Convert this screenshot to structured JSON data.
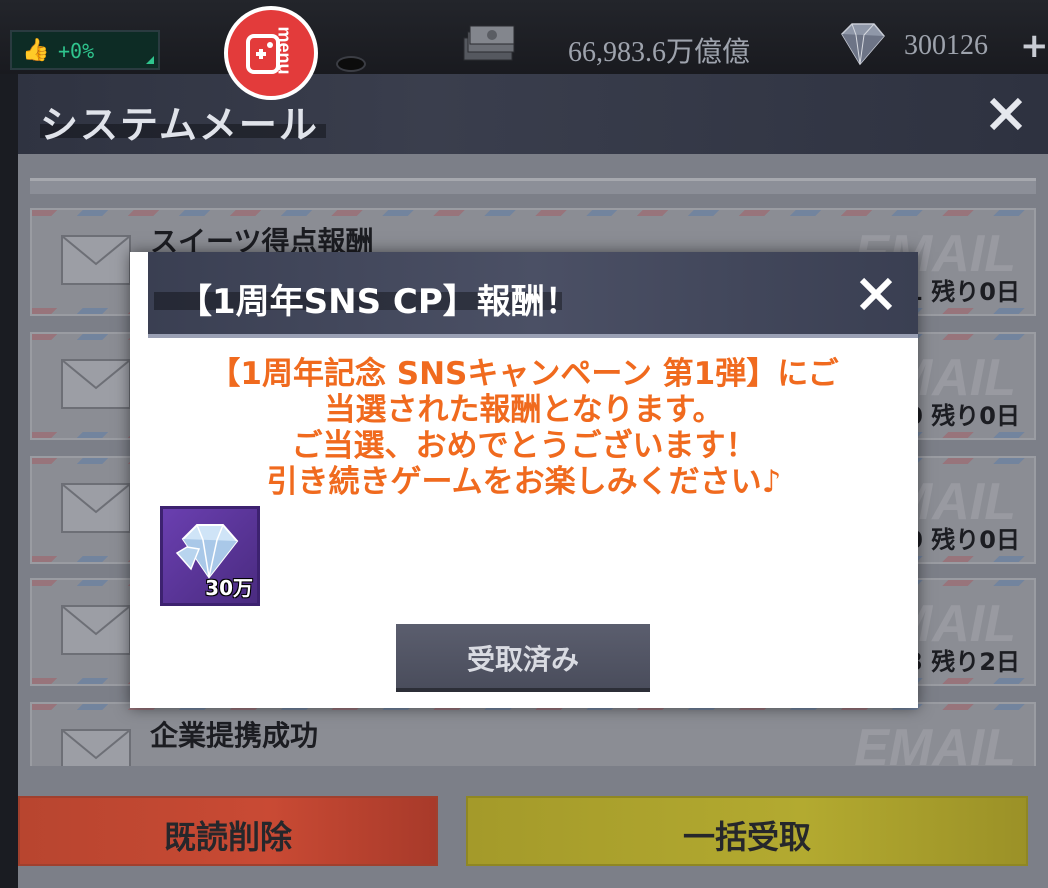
{
  "topbar": {
    "likes_percent": "+0%",
    "money_value": "66,983.6万億億",
    "gems_value": "300126",
    "plus_symbol": "+",
    "menu_label": "menu",
    "icons": [
      "thumbs-up-icon",
      "menu-gamepad-icon",
      "cash-stack-icon",
      "diamond-icon",
      "plus-icon"
    ]
  },
  "mail_window": {
    "title": "システムメール",
    "items": [
      {
        "title": "スイーツ得点報酬",
        "remaining": "1 残り0日"
      },
      {
        "title": "",
        "remaining": "0 残り0日"
      },
      {
        "title": "",
        "remaining": "0 残り0日"
      },
      {
        "title": "",
        "remaining": "3 残り2日"
      },
      {
        "title": "企業提携成功",
        "remaining": ""
      }
    ],
    "watermark": "EMAIL",
    "delete_read_label": "既読削除",
    "claim_all_label": "一括受取"
  },
  "popup": {
    "title": "【1周年SNS CP】報酬！",
    "message_lines": [
      "【1周年記念 SNSキャンペーン 第1弾】にご",
      "当選された報酬となります。",
      "ご当選、おめでとうございます！",
      "引き続きゲームをお楽しみください♪"
    ],
    "reward_quantity": "30万",
    "received_button_label": "受取済み"
  },
  "colors": {
    "message_orange": "#f06a1e",
    "delete_red": "#c94a34",
    "claim_yellow": "#b3aa30",
    "menu_red": "#e33b3b"
  }
}
